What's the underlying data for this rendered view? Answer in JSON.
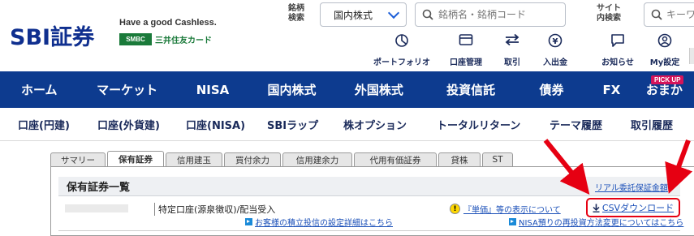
{
  "brand": {
    "logo_text": "SBI証券",
    "tagline": "Have a good Cashless.",
    "smbc_logo": "SMBC",
    "smbc_card": "三井住友カード"
  },
  "search": {
    "label": "銘柄\n検索",
    "market_value": "国内株式",
    "placeholder": "銘柄名・銘柄コード",
    "site_label": "サイト\n内検索",
    "site_placeholder": "キーワ"
  },
  "quick_links": [
    {
      "label": "ポートフォリオ",
      "icon": "pie-chart-icon"
    },
    {
      "label": "口座管理",
      "icon": "window-icon"
    },
    {
      "label": "取引",
      "icon": "transfer-arrows-icon"
    },
    {
      "label": "入出金",
      "icon": "yen-coin-icon"
    },
    {
      "label": "お知らせ",
      "icon": "message-icon"
    },
    {
      "label": "My設定",
      "icon": "user-settings-icon"
    }
  ],
  "global_nav": [
    "ホーム",
    "マーケット",
    "NISA",
    "国内株式",
    "外国株式",
    "投資信託",
    "債券",
    "FX",
    "おまか"
  ],
  "pickup_badge": "PICK UP",
  "sub_nav": [
    "口座(円建)",
    "口座(外貨建)",
    "口座(NISA)",
    "SBIラップ",
    "株オプション",
    "トータルリターン",
    "テーマ履歴",
    "取引履歴"
  ],
  "tabs": [
    "サマリー",
    "保有証券",
    "信用建玉",
    "買付余力",
    "信用建余力",
    "代用有価証券",
    "貸株",
    "ST"
  ],
  "active_tab": "保有証券",
  "panel": {
    "title": "保有証券一覧",
    "realtime_link": "リアル委託保証金額",
    "account_type": "特定口座(源泉徴収)/配当受入",
    "tanka_icon": "!",
    "tanka_link": "『単価』等の表示について",
    "csv_button": "CSVダウンロード",
    "link1": "お客様の積立投信の設定詳細はこちら",
    "link2": "NISA預りの再投資方法変更についてはこちら"
  },
  "colors": {
    "nav_bg": "#0d3b8f",
    "brand_blue": "#0f2f8f",
    "highlight_red": "#e60012",
    "link_blue": "#1a4fb8",
    "pickup_pink": "#d4145a"
  }
}
